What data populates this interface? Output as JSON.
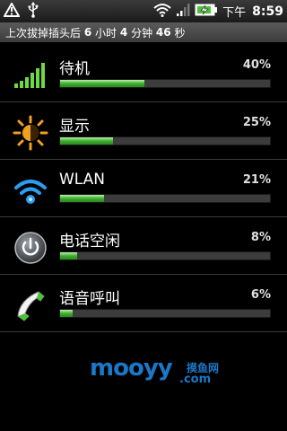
{
  "status_bar": {
    "ampm": "下午",
    "time": "8:59",
    "icons": [
      "alert-icon",
      "usb-icon",
      "wifi-icon",
      "signal-icon",
      "battery-charging-icon"
    ]
  },
  "info": {
    "prefix": "上次拔掉插头后",
    "hours": "6",
    "hours_unit": "小时",
    "minutes": "4",
    "minutes_unit": "分钟",
    "seconds": "46",
    "seconds_unit": "秒"
  },
  "items": [
    {
      "label": "待机",
      "percent": "40%",
      "value": 40,
      "icon": "signal-bars-icon"
    },
    {
      "label": "显示",
      "percent": "25%",
      "value": 25,
      "icon": "brightness-icon"
    },
    {
      "label": "WLAN",
      "percent": "21%",
      "value": 21,
      "icon": "wifi-icon"
    },
    {
      "label": "电话空闲",
      "percent": "8%",
      "value": 8,
      "icon": "power-icon"
    },
    {
      "label": "语音呼叫",
      "percent": "6%",
      "value": 6,
      "icon": "phone-handset-icon"
    }
  ],
  "watermark": {
    "brand": "mooyy",
    "cn": "摸鱼网",
    "domain": ".com"
  },
  "colors": {
    "bar_fill": "#3fae2f",
    "bar_track": "#3c3c3c",
    "logo": "#1a78c8"
  }
}
